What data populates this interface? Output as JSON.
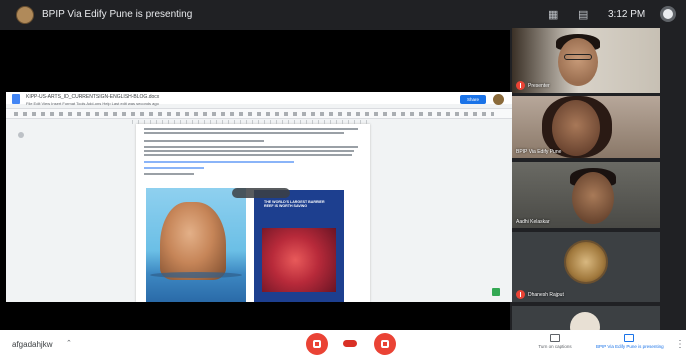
{
  "topbar": {
    "presenting_text": "BPIP Via Edify Pune is presenting",
    "clock": "3:12 PM",
    "icons": [
      "people-icon",
      "chat-icon"
    ]
  },
  "shared_doc": {
    "title": "KIPP-US-ARTS_ID_CURRENTSIGN-ENGLISH-BLOG.docx",
    "menu": "File  Edit  View  Insert  Format  Tools  Add-ons  Help  Last edit was seconds ago",
    "share_label": "Share",
    "poster_title": "THE WORLD'S LARGEST BARRIER REEF IS WORTH SAVING"
  },
  "participants": [
    {
      "name": "Presenter",
      "muted": true
    },
    {
      "name": "BPIP Via Edify Pune",
      "muted": false
    },
    {
      "name": "Aadhi Kelaskar",
      "muted": false
    },
    {
      "name": "Dhanesh Rajput",
      "muted": true
    },
    {
      "name": "",
      "muted": false
    }
  ],
  "bottombar": {
    "meeting_code": "afgadahjkw",
    "captions_label": "Turn on captions",
    "present_label": "BPIP Via Edify Pune is presenting"
  },
  "colors": {
    "accent": "#1a73e8",
    "danger": "#ea4335",
    "background": "#202124"
  }
}
